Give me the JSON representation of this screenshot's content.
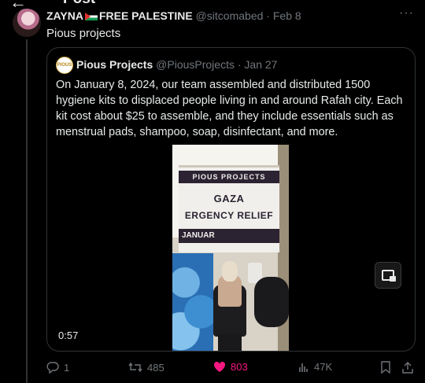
{
  "header": {
    "title": "Post",
    "back_icon": "arrow-left-icon"
  },
  "post": {
    "author_name": "ZAYNA",
    "author_suffix": "FREE PALESTINE",
    "handle": "@sitcomabed",
    "separator": "·",
    "date": "Feb 8",
    "more_label": "···",
    "text": "Pious projects"
  },
  "quote": {
    "avatar_text": "PIOUS",
    "author_name": "Pious Projects",
    "handle": "@PiousProjects",
    "separator": "·",
    "date": "Jan 27",
    "text": "On January 8, 2024, our team assembled and distributed 1500 hygiene kits to displaced people living in and around Rafah city. Each kit cost about $25 to assemble, and they include essentials such as menstrual pads, shampoo, soap, disinfectant, and more.",
    "video": {
      "duration": "0:57",
      "banner_top": "PIOUS PROJECTS",
      "banner_line1": "GAZA",
      "banner_line2": "ERGENCY RELIEF",
      "banner_bottom": "JANUAR"
    }
  },
  "actions": {
    "replies": "1",
    "reposts": "485",
    "likes": "803",
    "views": "47K",
    "like_color": "#f91880"
  }
}
